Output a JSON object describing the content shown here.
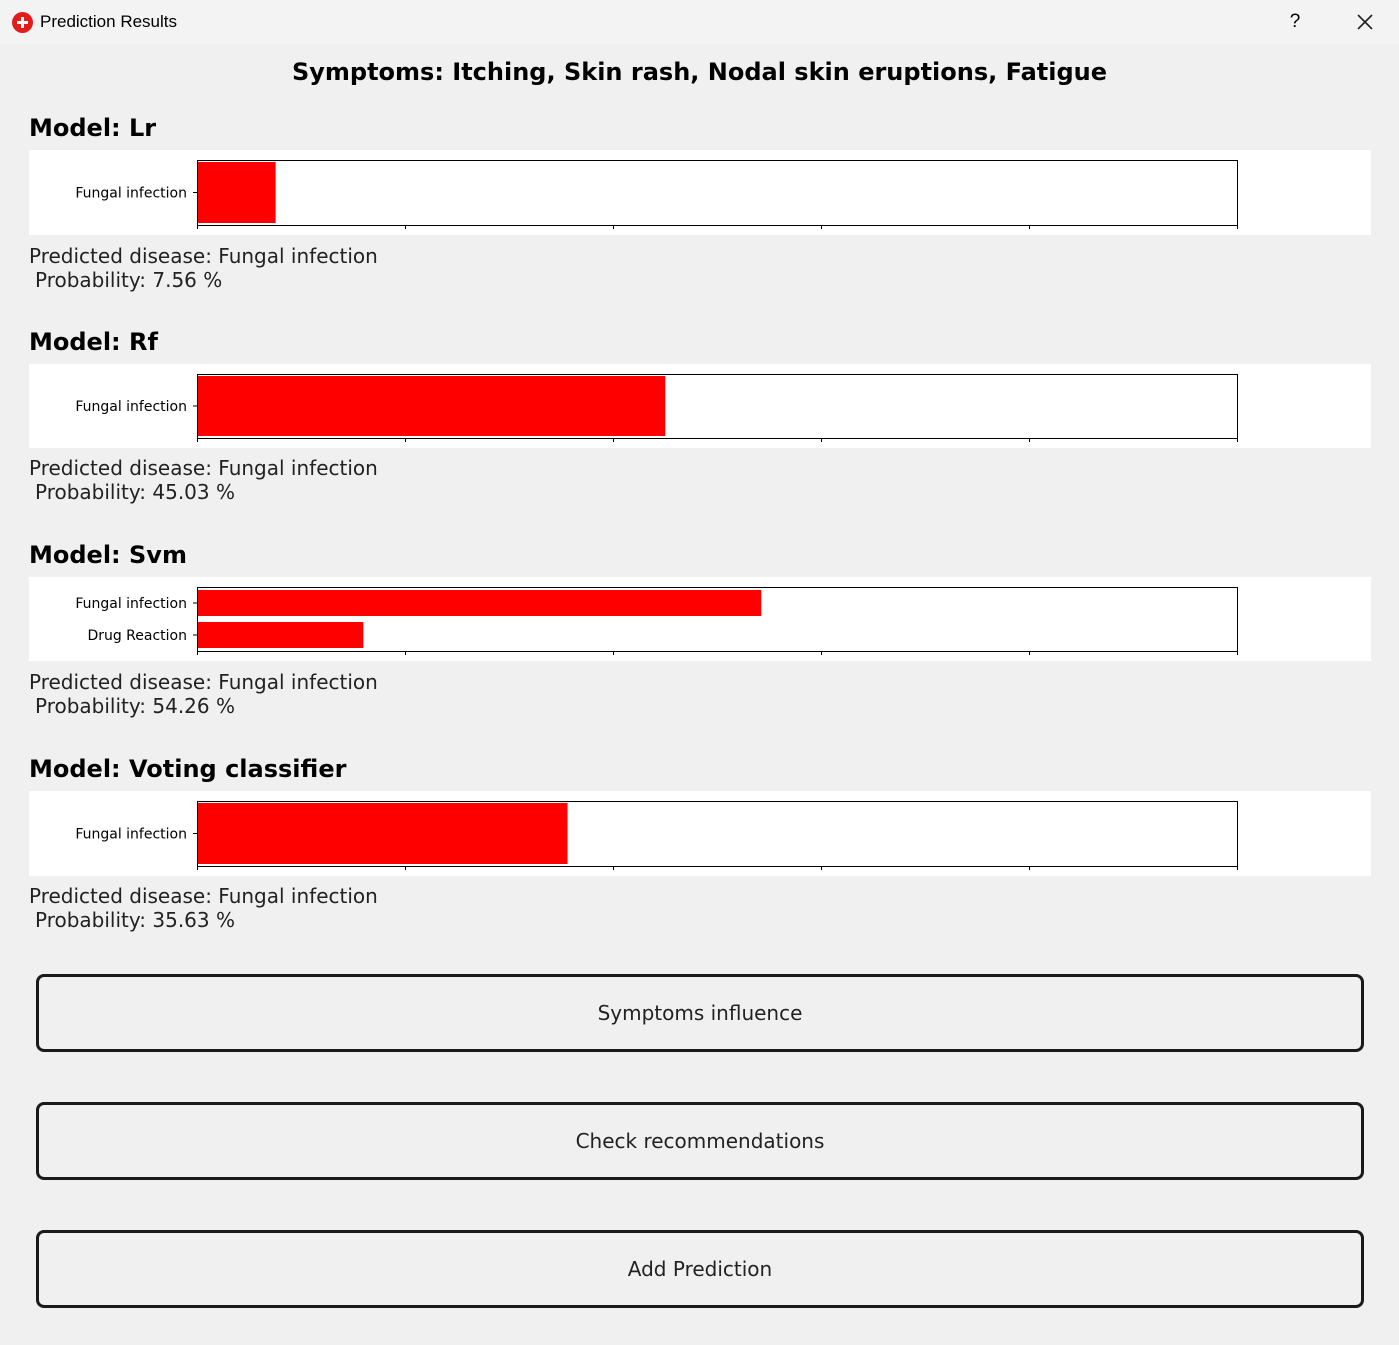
{
  "window": {
    "title": "Prediction Results",
    "help_label": "?",
    "close_icon": "close-icon",
    "app_icon": "red-cross-icon"
  },
  "symptoms_title": "Symptoms: Itching, Skin rash, Nodal skin eruptions, Fatigue",
  "bar_color": "#ff0000",
  "models": [
    {
      "title": "Model: Lr",
      "predicted": "Predicted disease: Fungal infection",
      "probability": " Probability: 7.56 %",
      "chart_data": {
        "type": "bar",
        "orientation": "horizontal",
        "categories": [
          "Fungal infection"
        ],
        "values": [
          7.56
        ],
        "xlim": [
          0,
          100
        ]
      }
    },
    {
      "title": "Model: Rf",
      "predicted": "Predicted disease: Fungal infection",
      "probability": " Probability: 45.03 %",
      "chart_data": {
        "type": "bar",
        "orientation": "horizontal",
        "categories": [
          "Fungal infection"
        ],
        "values": [
          45.03
        ],
        "xlim": [
          0,
          100
        ]
      }
    },
    {
      "title": "Model: Svm",
      "predicted": "Predicted disease: Fungal infection",
      "probability": " Probability: 54.26 %",
      "chart_data": {
        "type": "bar",
        "orientation": "horizontal",
        "categories": [
          "Fungal infection",
          "Drug Reaction"
        ],
        "values": [
          54.26,
          16.0
        ],
        "xlim": [
          0,
          100
        ]
      }
    },
    {
      "title": "Model: Voting classifier",
      "predicted": "Predicted disease: Fungal infection",
      "probability": " Probability: 35.63 %",
      "chart_data": {
        "type": "bar",
        "orientation": "horizontal",
        "categories": [
          "Fungal infection"
        ],
        "values": [
          35.63
        ],
        "xlim": [
          0,
          100
        ]
      }
    }
  ],
  "buttons": {
    "symptoms_influence": "Symptoms influence",
    "check_recommendations": "Check recommendations",
    "add_prediction": "Add Prediction"
  }
}
